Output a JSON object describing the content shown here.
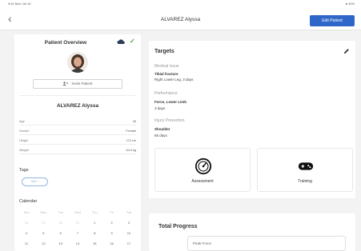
{
  "statusbar": {
    "left": "9:41 Mon Jul 10",
    "right": "● 40%"
  },
  "header": {
    "back_icon": "chevron-left-icon",
    "title": "ALVAREZ Alyssa",
    "edit_label": "Edit Patient"
  },
  "colors": {
    "accent": "#2f67c8",
    "cloud": "#2b3e57",
    "check": "#3aa64b",
    "tag_border": "#8db5e6"
  },
  "overview": {
    "title": "Patient Overview",
    "cloud_icon": "cloud-icon",
    "check_icon": "checkmark-icon",
    "invite_label": "Invite Patient",
    "name": "ALVAREZ Alyssa",
    "rows": [
      {
        "key": "Age",
        "value": "26"
      },
      {
        "key": "Gender",
        "value": "Female"
      },
      {
        "key": "Height",
        "value": "170 cm"
      },
      {
        "key": "Weight",
        "value": "64.0 kg"
      }
    ],
    "tags_label": "Tags",
    "tag_button": "Add +",
    "calendar_label": "Calendar",
    "calendar": {
      "headers": [
        "Sun",
        "Mon",
        "Tue",
        "Wed",
        "Thu",
        "Fri",
        "Sat"
      ],
      "weeks": [
        {
          "days": [
            "28",
            "29",
            "30",
            "31",
            "1",
            "2",
            "3"
          ],
          "prev_month_count": 4
        },
        {
          "days": [
            "4",
            "5",
            "6",
            "7",
            "8",
            "9",
            "10"
          ],
          "prev_month_count": 0
        },
        {
          "days": [
            "11",
            "12",
            "13",
            "14",
            "15",
            "16",
            "17"
          ],
          "prev_month_count": 0
        }
      ]
    }
  },
  "targets": {
    "title": "Targets",
    "edit_icon": "pencil-icon",
    "medical_label": "Medical Issue",
    "medical_main": "Tibial fracture",
    "medical_sub": "Right Lower Leg, 3 days",
    "performance_label": "Performance",
    "performance_main": "Force, Lower Limb",
    "performance_sub": "3 days",
    "injury_label": "Injury Prevention",
    "injury_main": "Shoulder",
    "injury_sub": "66 days"
  },
  "tiles": {
    "assessment": {
      "label": "Assessment",
      "icon": "speedometer-icon"
    },
    "training": {
      "label": "Training",
      "icon": "gamepad-icon"
    }
  },
  "progress": {
    "title": "Total Progress",
    "select_value": "Peak Force"
  }
}
